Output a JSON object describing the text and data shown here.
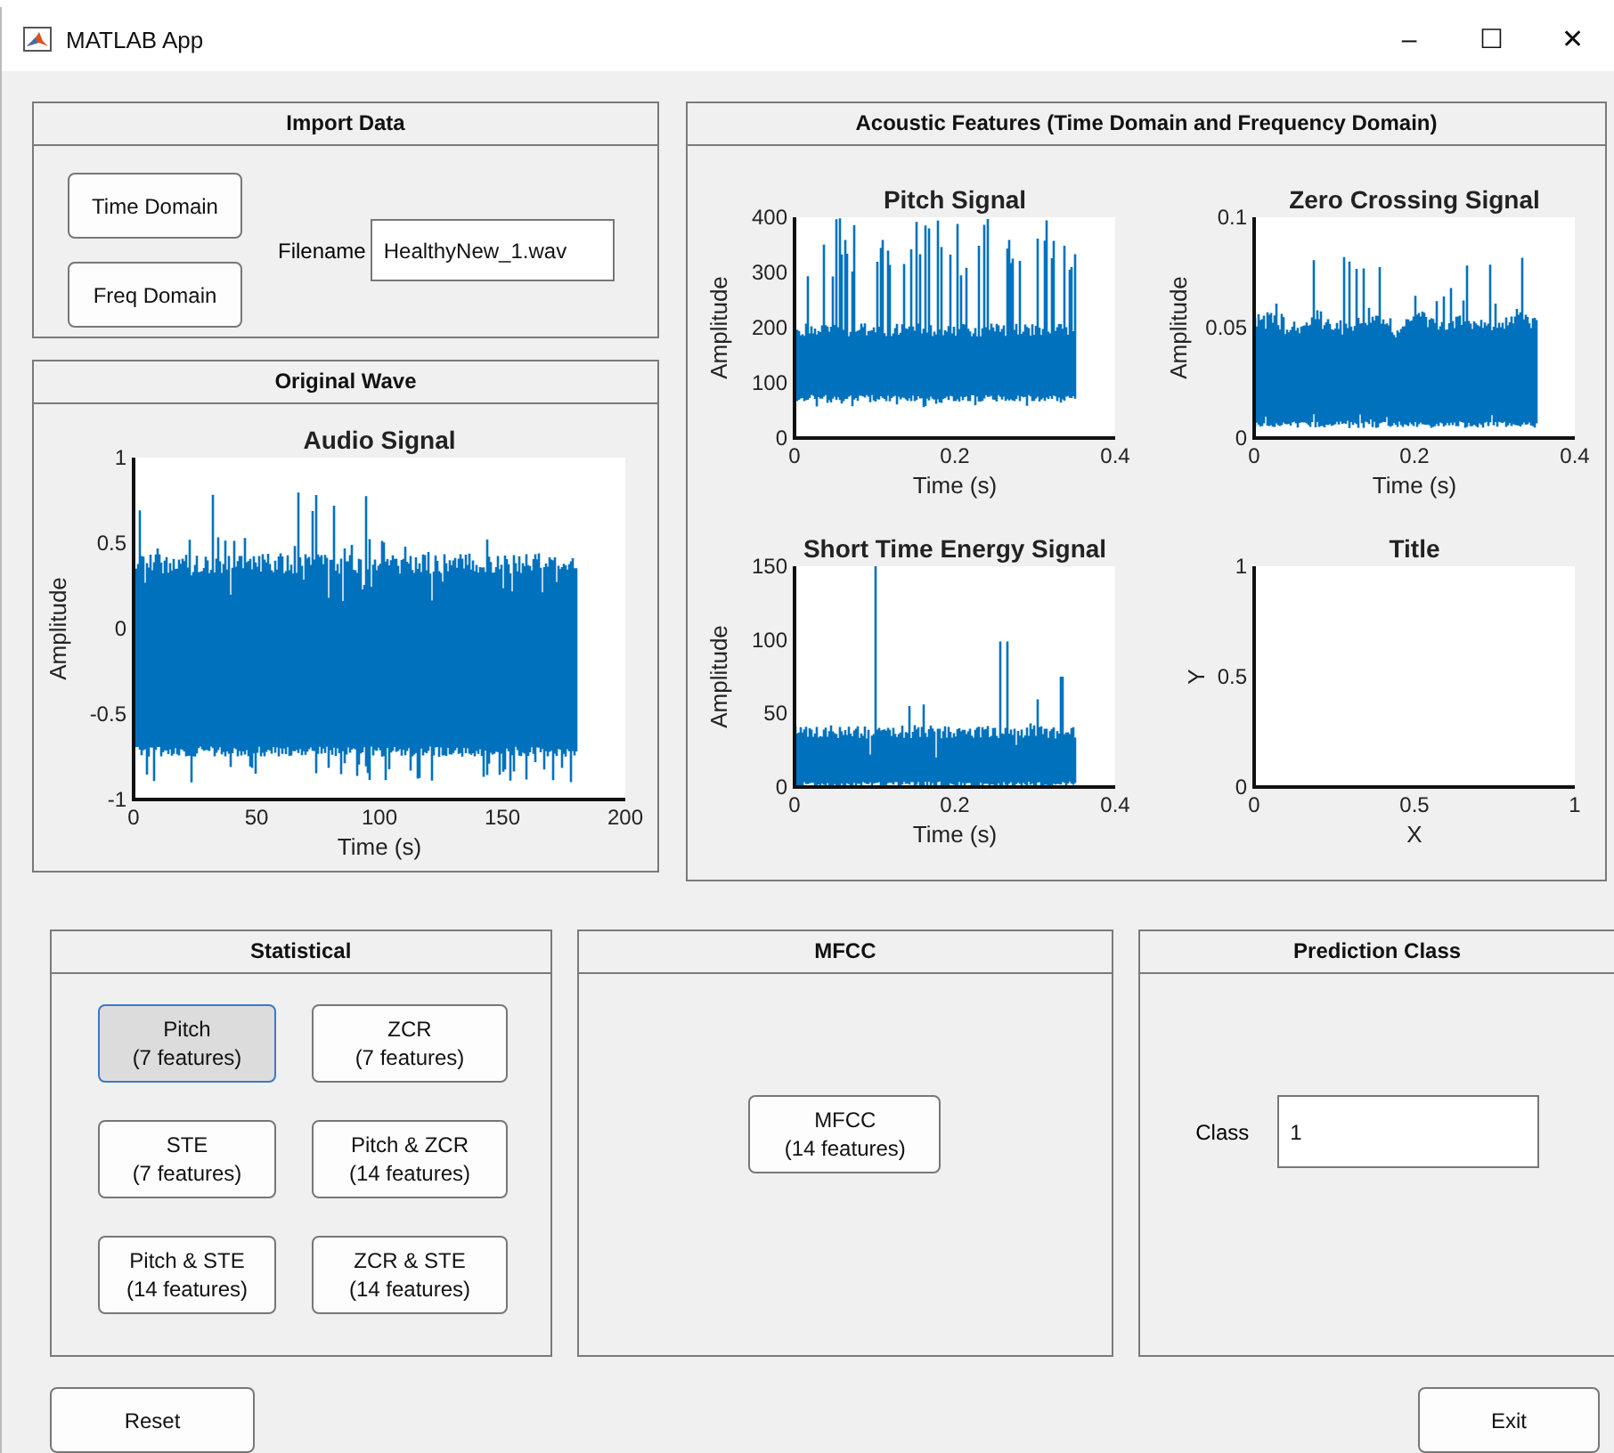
{
  "window": {
    "title": "MATLAB App",
    "controls": [
      "–",
      "☐",
      "✕"
    ]
  },
  "import_data": {
    "title": "Import Data",
    "buttons": [
      "Time Domain",
      "Freq Domain"
    ],
    "filename": {
      "label": "Filename",
      "value": "HealthyNew_1.wav"
    }
  },
  "original_wave": {
    "title": "Original Wave",
    "axes": {
      "kind": "audio",
      "title": "Audio Signal",
      "xlabel": "Time (s)",
      "ylabel": "Amplitude",
      "xticks": [
        "0",
        "50",
        "100",
        "150",
        "200"
      ],
      "yticks": [
        "1",
        "0.5",
        "0",
        "-0.5",
        "-1"
      ]
    }
  },
  "acoustic_features": {
    "title": "Acoustic Features (Time Domain and Frequency Domain)",
    "axes": [
      {
        "kind": "pitch",
        "title": "Pitch Signal",
        "xlabel": "Time (s)",
        "ylabel": "Amplitude",
        "xticks": [
          "0",
          "0.2",
          "0.4"
        ],
        "yticks": [
          "400",
          "300",
          "200",
          "100",
          "0"
        ]
      },
      {
        "kind": "zcr",
        "title": "Zero Crossing Signal",
        "xlabel": "Time (s)",
        "ylabel": "Amplitude",
        "xticks": [
          "0",
          "0.2",
          "0.4"
        ],
        "yticks": [
          "0.1",
          "0.05",
          "0"
        ]
      },
      {
        "kind": "energy",
        "title": "Short Time Energy Signal",
        "xlabel": "Time (s)",
        "ylabel": "Amplitude",
        "xticks": [
          "0",
          "0.2",
          "0.4"
        ],
        "yticks": [
          "150",
          "100",
          "50",
          "0"
        ]
      },
      {
        "kind": "empty",
        "title": "Title",
        "xlabel": "X",
        "ylabel": "Y",
        "xticks": [
          "0",
          "0.5",
          "1"
        ],
        "yticks": [
          "1",
          "0.5",
          "0"
        ]
      }
    ]
  },
  "statistical": {
    "title": "Statistical",
    "buttons": [
      {
        "label": "Pitch\n(7 features)",
        "selected": true
      },
      {
        "label": "ZCR\n(7 features)",
        "selected": false
      },
      {
        "label": "STE\n(7 features)",
        "selected": false
      },
      {
        "label": "Pitch & ZCR\n(14 features)",
        "selected": false
      },
      {
        "label": "Pitch & STE\n(14 features)",
        "selected": false
      },
      {
        "label": "ZCR & STE\n(14 features)",
        "selected": false
      }
    ]
  },
  "mfcc": {
    "title": "MFCC",
    "buttons": [
      {
        "label": "MFCC\n(14 features)",
        "selected": false
      }
    ]
  },
  "prediction_class": {
    "title": "Prediction Class",
    "class_field": {
      "label": "Class",
      "value": "1"
    }
  },
  "footer_buttons": [
    "Reset",
    "Exit"
  ]
}
